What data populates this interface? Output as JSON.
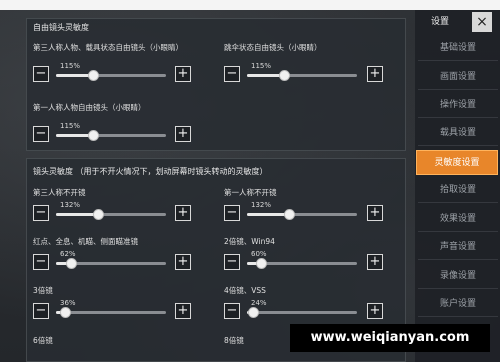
{
  "sidebar": {
    "title": "设置",
    "items": [
      {
        "label": "基础设置",
        "active": false
      },
      {
        "label": "画面设置",
        "active": false
      },
      {
        "label": "操作设置",
        "active": false
      },
      {
        "label": "载具设置",
        "active": false
      },
      {
        "label": "灵敏度设置",
        "active": true
      },
      {
        "label": "拾取设置",
        "active": false
      },
      {
        "label": "效果设置",
        "active": false
      },
      {
        "label": "声音设置",
        "active": false
      },
      {
        "label": "录像设置",
        "active": false
      },
      {
        "label": "账户设置",
        "active": false
      }
    ]
  },
  "free_camera": {
    "title": "自由镜头灵敏度",
    "sliders": [
      {
        "label": "第三人称人物、载具状态自由镜头（小眼睛）",
        "value": "115%",
        "fraction": 0.34
      },
      {
        "label": "跳伞状态自由镜头（小眼睛）",
        "value": "115%",
        "fraction": 0.34
      },
      {
        "label": "第一人称人物自由镜头（小眼睛）",
        "value": "115%",
        "fraction": 0.34
      }
    ]
  },
  "lens": {
    "title": "镜头灵敏度  （用于不开火情况下，划动屏幕时镜头转动的灵敏度）",
    "sliders": [
      {
        "label": "第三人称不开镜",
        "value": "132%",
        "fraction": 0.38
      },
      {
        "label": "第一人称不开镜",
        "value": "132%",
        "fraction": 0.38
      },
      {
        "label": "红点、全息、机瞄、侧面瞄准镜",
        "value": "62%",
        "fraction": 0.14
      },
      {
        "label": "2倍镜、Win94",
        "value": "60%",
        "fraction": 0.13
      },
      {
        "label": "3倍镜",
        "value": "36%",
        "fraction": 0.08
      },
      {
        "label": "4倍镜、VSS",
        "value": "24%",
        "fraction": 0.05
      }
    ],
    "partial_labels": [
      "6倍镜",
      "8倍镜"
    ]
  },
  "icons": {
    "minus": "−",
    "plus": "+",
    "close": "×"
  },
  "colors": {
    "accent": "#e8862a",
    "track": "#8a8d92"
  },
  "watermark": "www.weiqianyan.com"
}
